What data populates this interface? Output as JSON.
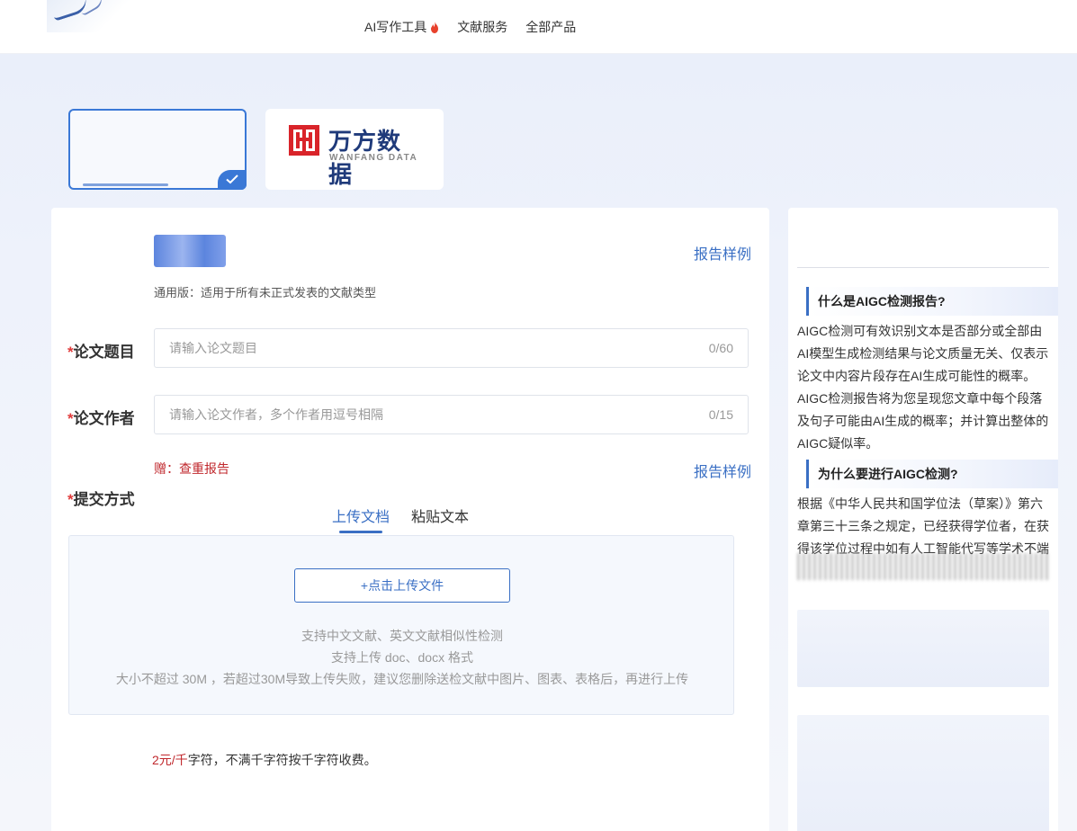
{
  "header": {
    "nav": [
      {
        "label": "AI写作工具",
        "hot": true
      },
      {
        "label": "文献服务",
        "hot": false
      },
      {
        "label": "全部产品",
        "hot": false
      }
    ]
  },
  "sources": {
    "wanfang_title": "万方数据",
    "wanfang_sub": "WANFANG DATA"
  },
  "form": {
    "sample_link": "报告样例",
    "description": "通用版：适用于所有未正式发表的文献类型",
    "title_label": "论文题目",
    "title_placeholder": "请输入论文题目",
    "title_counter": "0/60",
    "author_label": "论文作者",
    "author_placeholder": "请输入论文作者，多个作者用逗号相隔",
    "author_counter": "0/15",
    "gift": "赠：查重报告",
    "sample_link2": "报告样例",
    "submit_label": "提交方式",
    "tabs": [
      "上传文档",
      "粘贴文本"
    ],
    "upload_button": "+点击上传文件",
    "hints": [
      "支持中文文献、英文文献相似性检测",
      "支持上传 doc、docx 格式",
      "大小不超过 30M ，若超过30M导致上传失败，建议您删除送检文献中图片、图表、表格后，再进行上传"
    ],
    "price_red": "2元/千",
    "price_rest": "字符，不满千字符按千字符收费。"
  },
  "sidebar": {
    "heading1": "什么是AIGC检测报告?",
    "text1": "AIGC检测可有效识别文本是否部分或全部由AI模型生成检测结果与论文质量无关、仅表示论文中内容片段存在AI生成可能性的概率。AIGC检测报告将为您呈现您文章中每个段落及句子可能由AI生成的概率；并计算出整体的AIGC疑似率。",
    "heading2": "为什么要进行AIGC检测?",
    "text2": "根据《中华人民共和国学位法（草案）》第六章第三十三条之规定，已经获得学位者，在获得该学位过程中如有人工智能代写等学术不端"
  },
  "colors": {
    "accent": "#3a6fc4",
    "required": "#e03a3a",
    "price_red": "#c0282d"
  }
}
